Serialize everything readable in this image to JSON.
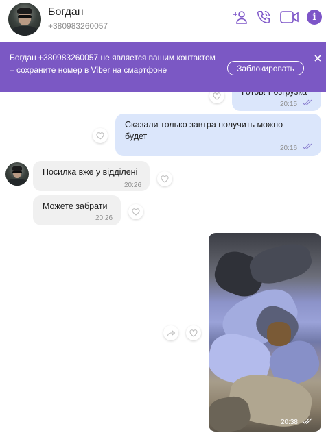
{
  "header": {
    "contact_name": "Богдан",
    "contact_phone": "+380983260057",
    "icons": [
      "add-contact-icon",
      "phone-icon",
      "video-call-icon",
      "info-icon"
    ],
    "info_glyph": "i",
    "accent_color": "#7d55c8"
  },
  "banner": {
    "text": "Богдан +380983260057 не является вашим контактом – сохраните номер в Viber на смартфоне",
    "block_label": "Заблокировать",
    "background": "#7b58c4"
  },
  "messages": [
    {
      "direction": "out",
      "text": "Готов! Розгрузка",
      "time": "20:15",
      "status": "read",
      "partially_hidden": true
    },
    {
      "direction": "out",
      "text": "Сказали только завтра получить можно будет",
      "time": "20:16",
      "status": "read"
    },
    {
      "direction": "in",
      "text": "Посилка вже у відділені",
      "time": "20:26"
    },
    {
      "direction": "in",
      "text": "Можете забрати",
      "time": "20:26"
    },
    {
      "direction": "out",
      "type": "photo",
      "time": "20:38",
      "status": "read"
    }
  ]
}
